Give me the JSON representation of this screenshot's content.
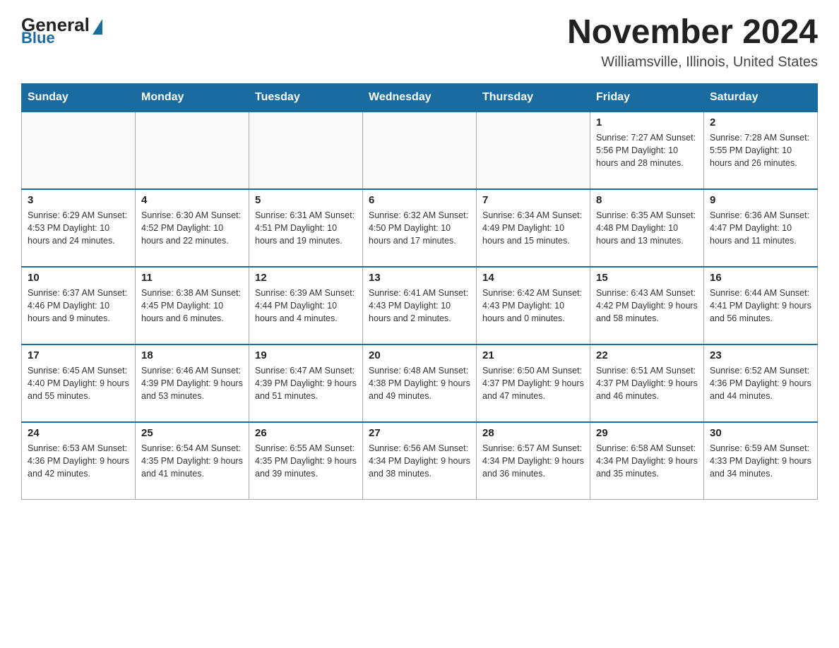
{
  "logo": {
    "general": "General",
    "blue": "Blue"
  },
  "header": {
    "title": "November 2024",
    "subtitle": "Williamsville, Illinois, United States"
  },
  "days_of_week": [
    "Sunday",
    "Monday",
    "Tuesday",
    "Wednesday",
    "Thursday",
    "Friday",
    "Saturday"
  ],
  "weeks": [
    [
      {
        "day": "",
        "info": ""
      },
      {
        "day": "",
        "info": ""
      },
      {
        "day": "",
        "info": ""
      },
      {
        "day": "",
        "info": ""
      },
      {
        "day": "",
        "info": ""
      },
      {
        "day": "1",
        "info": "Sunrise: 7:27 AM\nSunset: 5:56 PM\nDaylight: 10 hours and 28 minutes."
      },
      {
        "day": "2",
        "info": "Sunrise: 7:28 AM\nSunset: 5:55 PM\nDaylight: 10 hours and 26 minutes."
      }
    ],
    [
      {
        "day": "3",
        "info": "Sunrise: 6:29 AM\nSunset: 4:53 PM\nDaylight: 10 hours and 24 minutes."
      },
      {
        "day": "4",
        "info": "Sunrise: 6:30 AM\nSunset: 4:52 PM\nDaylight: 10 hours and 22 minutes."
      },
      {
        "day": "5",
        "info": "Sunrise: 6:31 AM\nSunset: 4:51 PM\nDaylight: 10 hours and 19 minutes."
      },
      {
        "day": "6",
        "info": "Sunrise: 6:32 AM\nSunset: 4:50 PM\nDaylight: 10 hours and 17 minutes."
      },
      {
        "day": "7",
        "info": "Sunrise: 6:34 AM\nSunset: 4:49 PM\nDaylight: 10 hours and 15 minutes."
      },
      {
        "day": "8",
        "info": "Sunrise: 6:35 AM\nSunset: 4:48 PM\nDaylight: 10 hours and 13 minutes."
      },
      {
        "day": "9",
        "info": "Sunrise: 6:36 AM\nSunset: 4:47 PM\nDaylight: 10 hours and 11 minutes."
      }
    ],
    [
      {
        "day": "10",
        "info": "Sunrise: 6:37 AM\nSunset: 4:46 PM\nDaylight: 10 hours and 9 minutes."
      },
      {
        "day": "11",
        "info": "Sunrise: 6:38 AM\nSunset: 4:45 PM\nDaylight: 10 hours and 6 minutes."
      },
      {
        "day": "12",
        "info": "Sunrise: 6:39 AM\nSunset: 4:44 PM\nDaylight: 10 hours and 4 minutes."
      },
      {
        "day": "13",
        "info": "Sunrise: 6:41 AM\nSunset: 4:43 PM\nDaylight: 10 hours and 2 minutes."
      },
      {
        "day": "14",
        "info": "Sunrise: 6:42 AM\nSunset: 4:43 PM\nDaylight: 10 hours and 0 minutes."
      },
      {
        "day": "15",
        "info": "Sunrise: 6:43 AM\nSunset: 4:42 PM\nDaylight: 9 hours and 58 minutes."
      },
      {
        "day": "16",
        "info": "Sunrise: 6:44 AM\nSunset: 4:41 PM\nDaylight: 9 hours and 56 minutes."
      }
    ],
    [
      {
        "day": "17",
        "info": "Sunrise: 6:45 AM\nSunset: 4:40 PM\nDaylight: 9 hours and 55 minutes."
      },
      {
        "day": "18",
        "info": "Sunrise: 6:46 AM\nSunset: 4:39 PM\nDaylight: 9 hours and 53 minutes."
      },
      {
        "day": "19",
        "info": "Sunrise: 6:47 AM\nSunset: 4:39 PM\nDaylight: 9 hours and 51 minutes."
      },
      {
        "day": "20",
        "info": "Sunrise: 6:48 AM\nSunset: 4:38 PM\nDaylight: 9 hours and 49 minutes."
      },
      {
        "day": "21",
        "info": "Sunrise: 6:50 AM\nSunset: 4:37 PM\nDaylight: 9 hours and 47 minutes."
      },
      {
        "day": "22",
        "info": "Sunrise: 6:51 AM\nSunset: 4:37 PM\nDaylight: 9 hours and 46 minutes."
      },
      {
        "day": "23",
        "info": "Sunrise: 6:52 AM\nSunset: 4:36 PM\nDaylight: 9 hours and 44 minutes."
      }
    ],
    [
      {
        "day": "24",
        "info": "Sunrise: 6:53 AM\nSunset: 4:36 PM\nDaylight: 9 hours and 42 minutes."
      },
      {
        "day": "25",
        "info": "Sunrise: 6:54 AM\nSunset: 4:35 PM\nDaylight: 9 hours and 41 minutes."
      },
      {
        "day": "26",
        "info": "Sunrise: 6:55 AM\nSunset: 4:35 PM\nDaylight: 9 hours and 39 minutes."
      },
      {
        "day": "27",
        "info": "Sunrise: 6:56 AM\nSunset: 4:34 PM\nDaylight: 9 hours and 38 minutes."
      },
      {
        "day": "28",
        "info": "Sunrise: 6:57 AM\nSunset: 4:34 PM\nDaylight: 9 hours and 36 minutes."
      },
      {
        "day": "29",
        "info": "Sunrise: 6:58 AM\nSunset: 4:34 PM\nDaylight: 9 hours and 35 minutes."
      },
      {
        "day": "30",
        "info": "Sunrise: 6:59 AM\nSunset: 4:33 PM\nDaylight: 9 hours and 34 minutes."
      }
    ]
  ]
}
